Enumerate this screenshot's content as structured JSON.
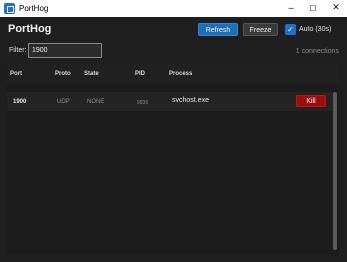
{
  "window": {
    "title": "PortHog",
    "minimize_glyph": "─",
    "maximize_glyph": "☐",
    "close_glyph": "✕"
  },
  "header": {
    "title": "PortHog",
    "refresh_label": "Refresh",
    "freeze_label": "Freeze",
    "auto_label": "Auto (30s)",
    "auto_checked": true,
    "auto_check_glyph": "✓"
  },
  "filter": {
    "label": "Filter:",
    "value": "1900",
    "placeholder": ""
  },
  "status": {
    "connections": "1 connections"
  },
  "table": {
    "columns": [
      "Port",
      "Proto",
      "State",
      "PID",
      "Process"
    ],
    "rows": [
      {
        "port": "1900",
        "proto": "UDP",
        "state": "NONE",
        "pid": "9936",
        "process": "svchost.exe",
        "action": "Kill"
      }
    ]
  },
  "colors": {
    "accent": "#1f6fb4",
    "danger": "#9b0d0d",
    "background": "#1e1e1e"
  },
  "icons": {
    "app": "porthog-app-icon",
    "checkbox": "checkmark-icon"
  }
}
